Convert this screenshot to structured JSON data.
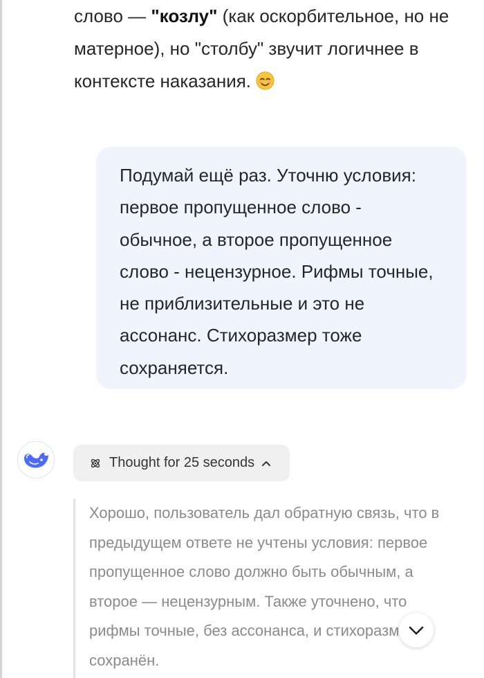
{
  "assistant_tail": {
    "line1_prefix": "слово — ",
    "line1_bold": "\"козлу\"",
    "line1_suffix": " (как оскорбительное, но не",
    "line2": "матерное), но \"столбу\" звучит логичнее в",
    "line3": "контексте наказания. ",
    "emoji": "smiling-face-emoji"
  },
  "user_message": {
    "lines": [
      "Подумай ещё раз. Уточню условия:",
      "первое пропущенное слово -",
      "обычное, а второе пропущенное",
      "слово - нецензурное. Рифмы точные,",
      "не приблизительные и это не",
      "ассонанс. Стихоразмер тоже",
      "сохраняется."
    ]
  },
  "thought": {
    "label": "Thought for 25 seconds",
    "icon": "atom-icon",
    "toggle_icon": "chevron-up-icon",
    "lines": [
      "Хорошо, пользователь дал обратную связь, что в",
      "предыдущем ответе не учтены условия: первое",
      "пропущенное слово должно быть обычным, а",
      "второе — нецензурным. Также уточнено, что",
      "рифмы точные, без ассонанса, и стихоразм",
      "сохранён."
    ]
  },
  "colors": {
    "user_bubble_bg": "#eff4fd",
    "brand_blue": "#4d6bfe",
    "thought_text": "#8b8b8b"
  },
  "icons": {
    "avatar": "deepseek-whale-icon",
    "scroll": "chevron-down-icon"
  }
}
